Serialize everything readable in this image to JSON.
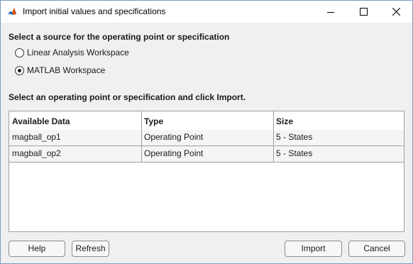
{
  "window": {
    "title": "Import initial values and specifications",
    "icon": "matlab-icon"
  },
  "source": {
    "heading": "Select a source for the operating point or specification",
    "options": [
      {
        "label": "Linear Analysis Workspace",
        "selected": false
      },
      {
        "label": "MATLAB Workspace",
        "selected": true
      }
    ]
  },
  "instruction": "Select an operating point or specification and click Import.",
  "table": {
    "columns": [
      "Available Data",
      "Type",
      "Size"
    ],
    "rows": [
      [
        "magball_op1",
        "Operating Point",
        "5 - States"
      ],
      [
        "magball_op2",
        "Operating Point",
        "5 - States"
      ]
    ]
  },
  "buttons": {
    "help": "Help",
    "refresh": "Refresh",
    "import": "Import",
    "cancel": "Cancel"
  }
}
